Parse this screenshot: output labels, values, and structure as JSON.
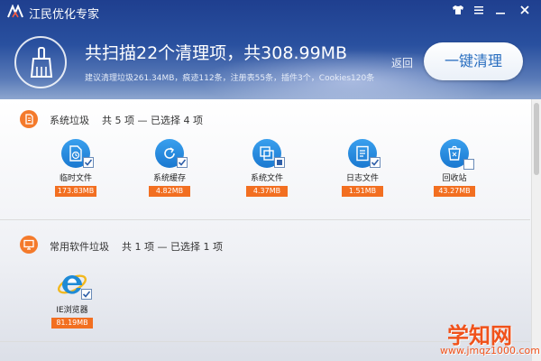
{
  "window": {
    "title": "江民优化专家",
    "controls": [
      "shirt-icon",
      "menu-icon",
      "minimize-icon",
      "close-icon"
    ]
  },
  "header": {
    "summary": "共扫描22个清理项，共308.99MB",
    "details": "建议清理垃圾261.34MB，痕迹112条，注册表55条，插件3个，Cookies120条",
    "back_label": "返回",
    "clean_button_label": "一键清理"
  },
  "sections": [
    {
      "title": "系统垃圾",
      "count_text": "共 5 项 — 已选择 4 项",
      "icon": "trash-doc-icon",
      "items": [
        {
          "label": "临时文件",
          "size": "173.83MB",
          "checked": true,
          "icon": "clock-file-icon"
        },
        {
          "label": "系统缓存",
          "size": "4.82MB",
          "checked": true,
          "icon": "refresh-icon"
        },
        {
          "label": "系统文件",
          "size": "4.37MB",
          "checked": "partial",
          "icon": "windows-file-icon"
        },
        {
          "label": "日志文件",
          "size": "1.51MB",
          "checked": true,
          "icon": "log-file-icon"
        },
        {
          "label": "回收站",
          "size": "43.27MB",
          "checked": false,
          "icon": "recycle-bin-icon"
        }
      ]
    },
    {
      "title": "常用软件垃圾",
      "count_text": "共 1 项 — 已选择 1 项",
      "icon": "monitor-icon",
      "items": [
        {
          "label": "IE浏览器",
          "size": "81.19MB",
          "checked": true,
          "icon": "ie-browser-icon"
        }
      ]
    }
  ],
  "watermark": {
    "name": "学知网",
    "url": "www.jmqz1000.com"
  },
  "colors": {
    "header_top": "#1f3f8f",
    "accent_orange": "#f26f21",
    "icon_blue": "#1a78d0",
    "button_text": "#2a6fc0"
  }
}
